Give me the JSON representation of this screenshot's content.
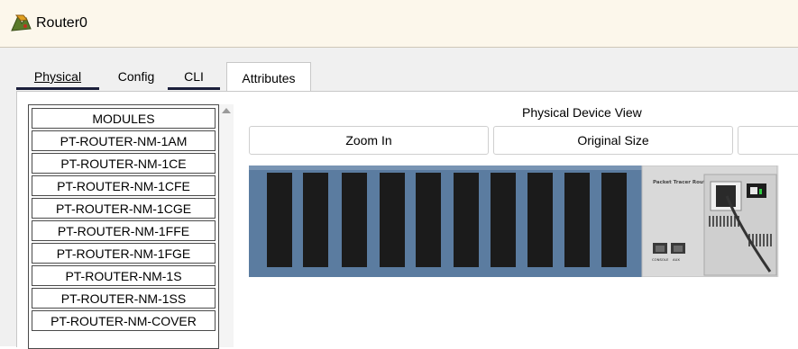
{
  "window": {
    "title": "Router0",
    "icon": "router-icon"
  },
  "tabs": [
    {
      "label": "Physical"
    },
    {
      "label": "Config"
    },
    {
      "label": "CLI"
    },
    {
      "label": "Attributes"
    }
  ],
  "modules": {
    "header": "MODULES",
    "items": [
      "PT-ROUTER-NM-1AM",
      "PT-ROUTER-NM-1CE",
      "PT-ROUTER-NM-1CFE",
      "PT-ROUTER-NM-1CGE",
      "PT-ROUTER-NM-1FFE",
      "PT-ROUTER-NM-1FGE",
      "PT-ROUTER-NM-1S",
      "PT-ROUTER-NM-1SS",
      "PT-ROUTER-NM-COVER"
    ]
  },
  "device_view": {
    "title": "Physical Device View",
    "zoom_in_label": "Zoom In",
    "original_size_label": "Original Size",
    "chassis_label": "Packet Tracer Router",
    "console_label": "CONSOLE",
    "aux_label": "AUX"
  },
  "colors": {
    "chassis_blue": "#5b7ca0",
    "slot": "#1b1b1b",
    "tab_underline": "#1b1f3b"
  }
}
